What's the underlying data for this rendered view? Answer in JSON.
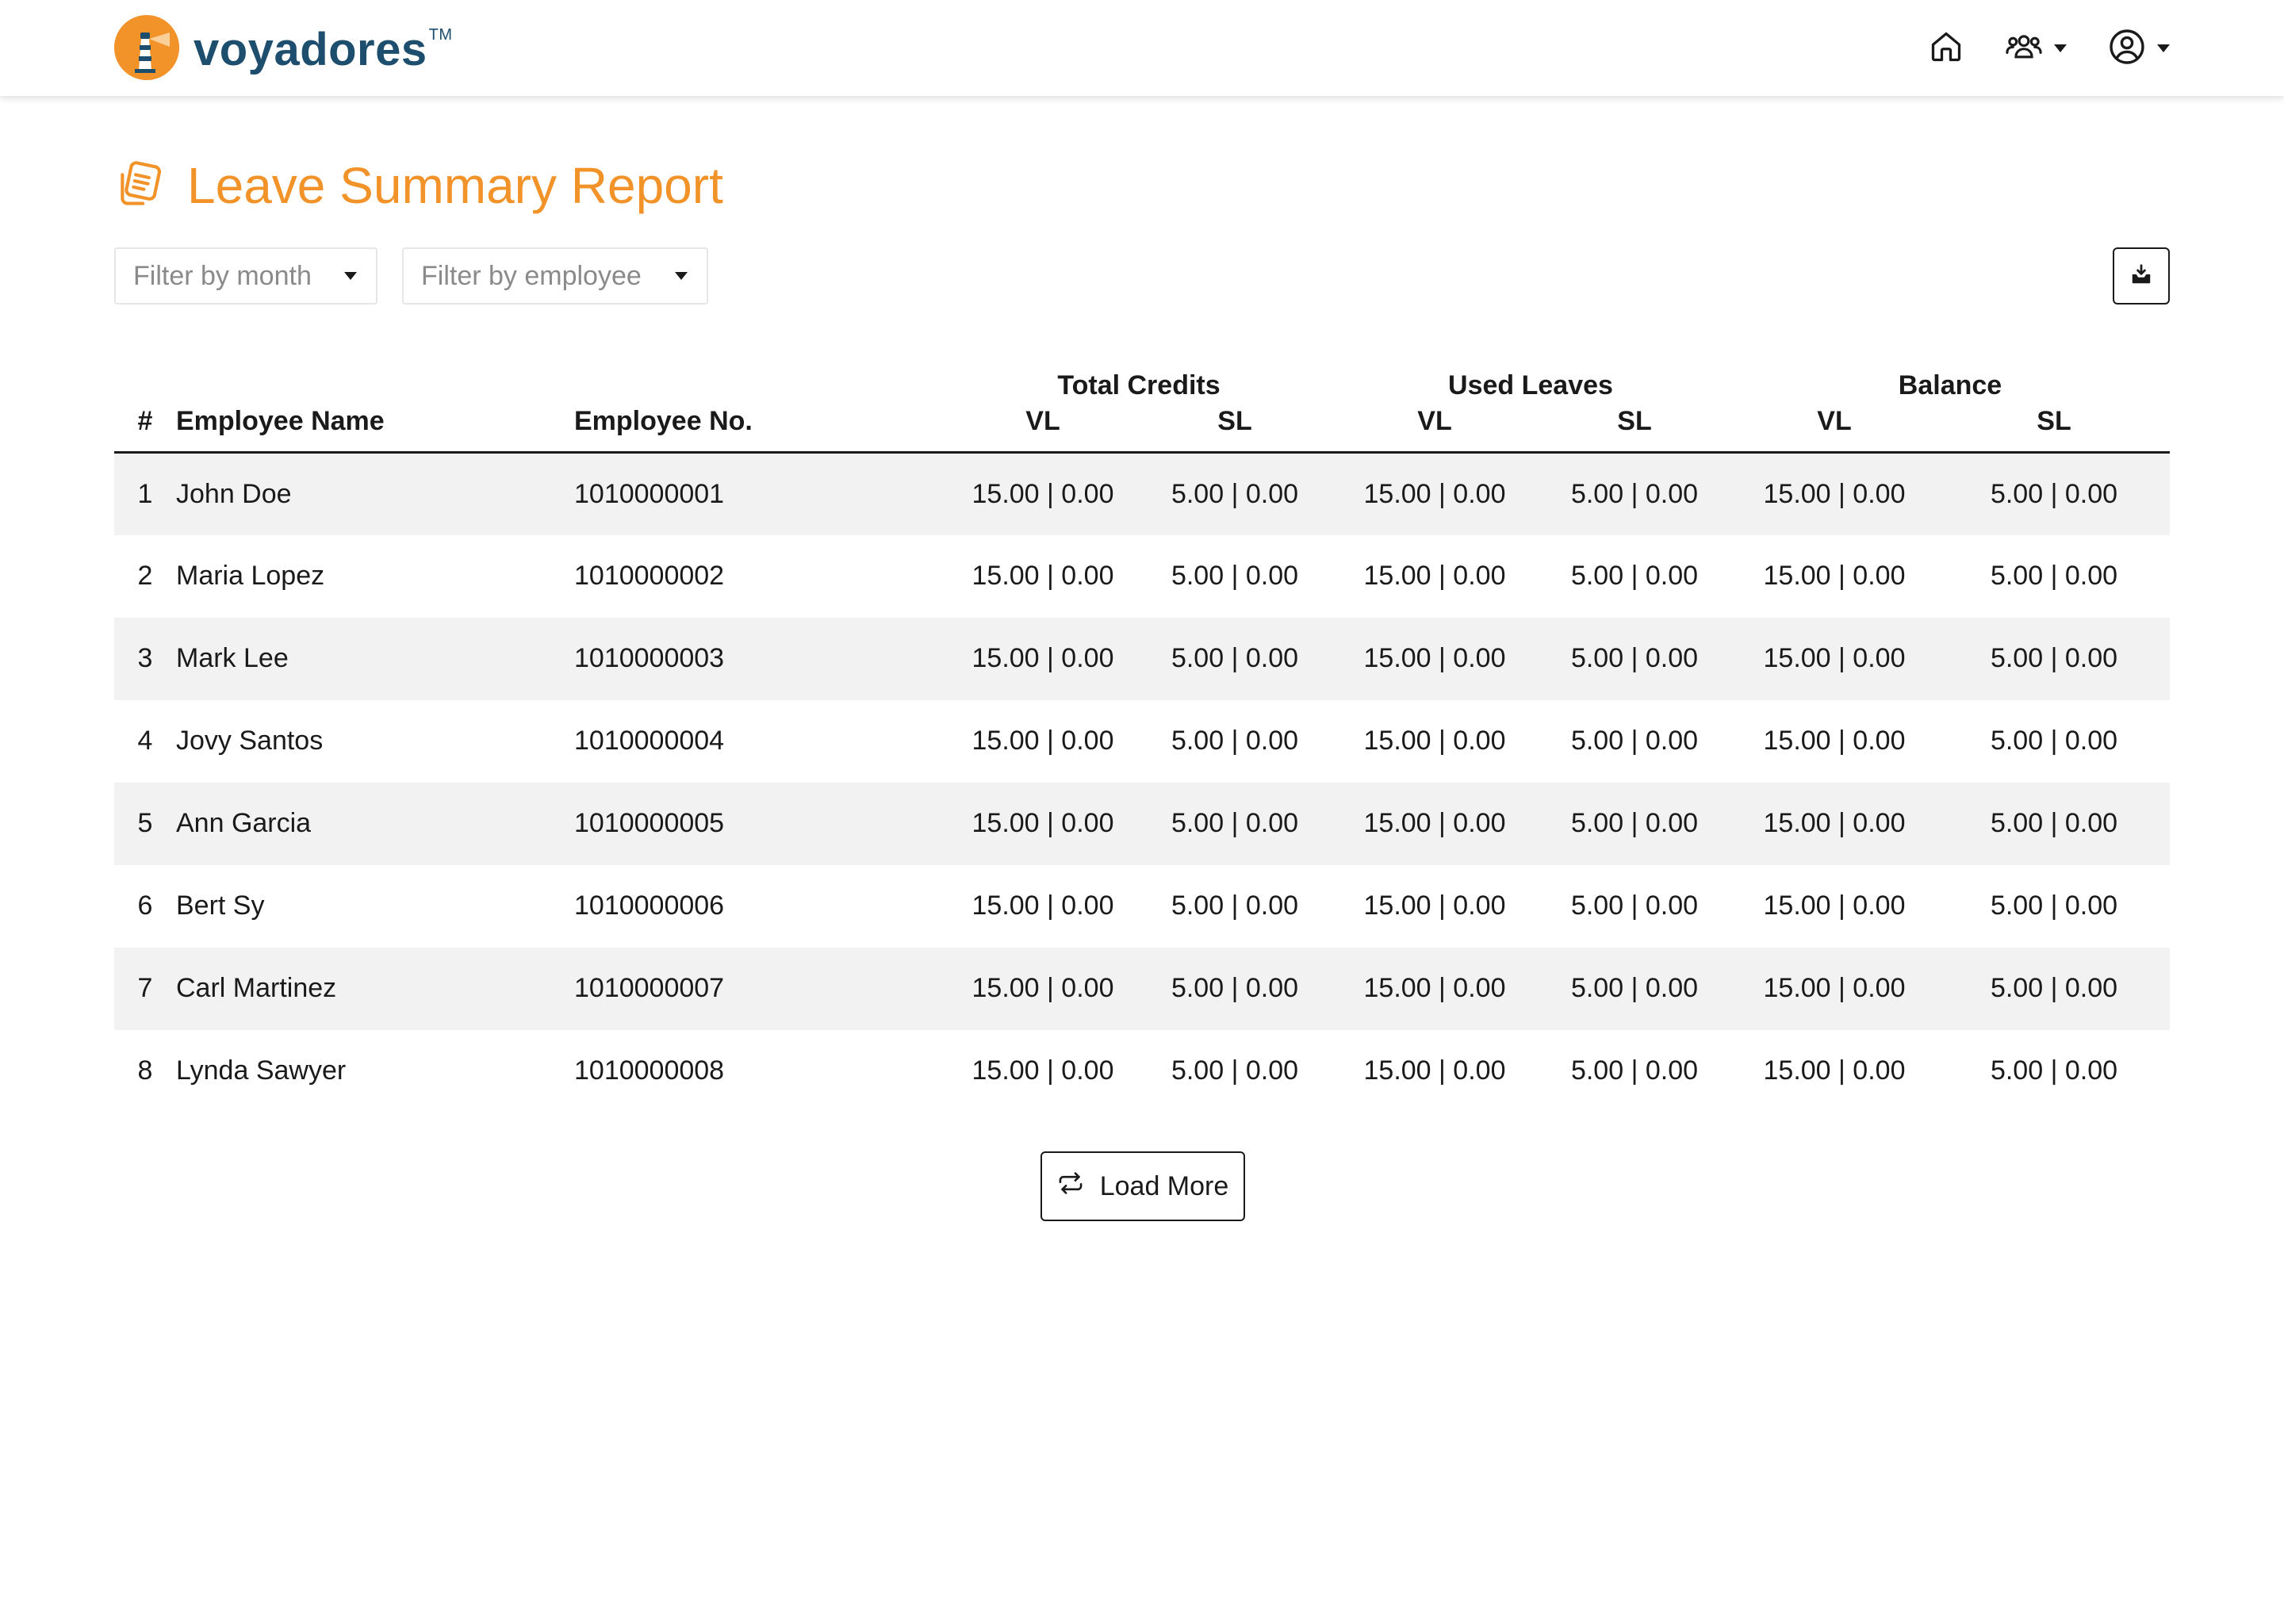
{
  "brand": {
    "name": "voyadores",
    "trademark": "TM",
    "logo_icon": "lighthouse-icon",
    "colors": {
      "accent": "#f2932a",
      "brand_text": "#1d4e6e"
    }
  },
  "nav": {
    "home_icon": "home-icon",
    "team_icon": "users-icon",
    "account_icon": "user-circle-icon"
  },
  "page": {
    "title": "Leave Summary Report",
    "title_icon": "documents-icon"
  },
  "filters": {
    "month_placeholder": "Filter by month",
    "employee_placeholder": "Filter by employee"
  },
  "export": {
    "icon": "download-tray-icon"
  },
  "table": {
    "group_headers": [
      "Total Credits",
      "Used Leaves",
      "Balance"
    ],
    "columns": {
      "num": "#",
      "name": "Employee Name",
      "employee_no": "Employee No.",
      "vl": "VL",
      "sl": "SL"
    },
    "rows": [
      {
        "num": "1",
        "name": "John Doe",
        "employee_no": "1010000001",
        "tc_vl": "15.00 | 0.00",
        "tc_sl": "5.00 | 0.00",
        "ul_vl": "15.00 | 0.00",
        "ul_sl": "5.00 | 0.00",
        "bal_vl": "15.00 | 0.00",
        "bal_sl": "5.00 | 0.00"
      },
      {
        "num": "2",
        "name": "Maria Lopez",
        "employee_no": "1010000002",
        "tc_vl": "15.00 | 0.00",
        "tc_sl": "5.00 | 0.00",
        "ul_vl": "15.00 | 0.00",
        "ul_sl": "5.00 | 0.00",
        "bal_vl": "15.00 | 0.00",
        "bal_sl": "5.00 | 0.00"
      },
      {
        "num": "3",
        "name": "Mark Lee",
        "employee_no": "1010000003",
        "tc_vl": "15.00 | 0.00",
        "tc_sl": "5.00 | 0.00",
        "ul_vl": "15.00 | 0.00",
        "ul_sl": "5.00 | 0.00",
        "bal_vl": "15.00 | 0.00",
        "bal_sl": "5.00 | 0.00"
      },
      {
        "num": "4",
        "name": "Jovy Santos",
        "employee_no": "1010000004",
        "tc_vl": "15.00 | 0.00",
        "tc_sl": "5.00 | 0.00",
        "ul_vl": "15.00 | 0.00",
        "ul_sl": "5.00 | 0.00",
        "bal_vl": "15.00 | 0.00",
        "bal_sl": "5.00 | 0.00"
      },
      {
        "num": "5",
        "name": "Ann Garcia",
        "employee_no": "1010000005",
        "tc_vl": "15.00 | 0.00",
        "tc_sl": "5.00 | 0.00",
        "ul_vl": "15.00 | 0.00",
        "ul_sl": "5.00 | 0.00",
        "bal_vl": "15.00 | 0.00",
        "bal_sl": "5.00 | 0.00"
      },
      {
        "num": "6",
        "name": "Bert Sy",
        "employee_no": "1010000006",
        "tc_vl": "15.00 | 0.00",
        "tc_sl": "5.00 | 0.00",
        "ul_vl": "15.00 | 0.00",
        "ul_sl": "5.00 | 0.00",
        "bal_vl": "15.00 | 0.00",
        "bal_sl": "5.00 | 0.00"
      },
      {
        "num": "7",
        "name": "Carl Martinez",
        "employee_no": "1010000007",
        "tc_vl": "15.00 | 0.00",
        "tc_sl": "5.00 | 0.00",
        "ul_vl": "15.00 | 0.00",
        "ul_sl": "5.00 | 0.00",
        "bal_vl": "15.00 | 0.00",
        "bal_sl": "5.00 | 0.00"
      },
      {
        "num": "8",
        "name": "Lynda Sawyer",
        "employee_no": "1010000008",
        "tc_vl": "15.00 | 0.00",
        "tc_sl": "5.00 | 0.00",
        "ul_vl": "15.00 | 0.00",
        "ul_sl": "5.00 | 0.00",
        "bal_vl": "15.00 | 0.00",
        "bal_sl": "5.00 | 0.00"
      }
    ],
    "row_colors": {
      "striped": "#f2f2f2",
      "plain": "#ffffff"
    }
  },
  "load_more": {
    "label": "Load More",
    "icon": "repeat-arrows-icon"
  }
}
